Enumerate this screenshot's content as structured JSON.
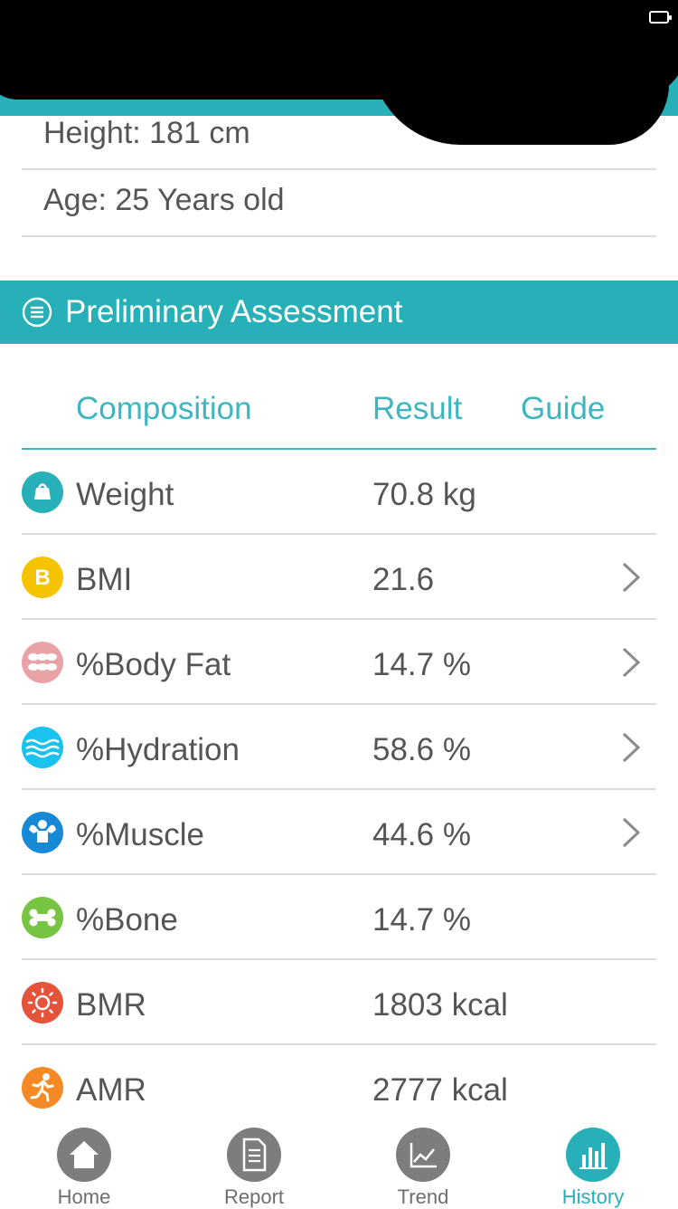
{
  "profile": {
    "height": "Height: 181 cm",
    "age": "Age: 25 Years old"
  },
  "section": {
    "title": "Preliminary Assessment"
  },
  "columns": {
    "composition": "Composition",
    "result": "Result",
    "guide": "Guide"
  },
  "rows": [
    {
      "name": "Weight",
      "value": "70.8 kg",
      "icon": "weight-icon",
      "color": "#27b0b8",
      "has_guide": false
    },
    {
      "name": "BMI",
      "value": "21.6",
      "icon": "bmi-icon",
      "color": "#f6c300",
      "has_guide": true
    },
    {
      "name": "%Body Fat",
      "value": "14.7 %",
      "icon": "body-fat-icon",
      "color": "#e9a3a7",
      "has_guide": true
    },
    {
      "name": "%Hydration",
      "value": "58.6 %",
      "icon": "hydration-icon",
      "color": "#19c2ef",
      "has_guide": true
    },
    {
      "name": "%Muscle",
      "value": "44.6 %",
      "icon": "muscle-icon",
      "color": "#1789d6",
      "has_guide": true
    },
    {
      "name": "%Bone",
      "value": "14.7 %",
      "icon": "bone-icon",
      "color": "#76c442",
      "has_guide": false
    },
    {
      "name": "BMR",
      "value": "1803 kcal",
      "icon": "bmr-icon",
      "color": "#e4533a",
      "has_guide": false
    },
    {
      "name": "AMR",
      "value": "2777 kcal",
      "icon": "amr-icon",
      "color": "#f58a24",
      "has_guide": false
    }
  ],
  "tabs": [
    {
      "label": "Home",
      "icon": "home-icon"
    },
    {
      "label": "Report",
      "icon": "report-icon"
    },
    {
      "label": "Trend",
      "icon": "trend-icon"
    },
    {
      "label": "History",
      "icon": "history-icon",
      "active": true
    }
  ],
  "colors": {
    "accent": "#27b0b8",
    "inactive_tab": "#7d7d7d"
  }
}
